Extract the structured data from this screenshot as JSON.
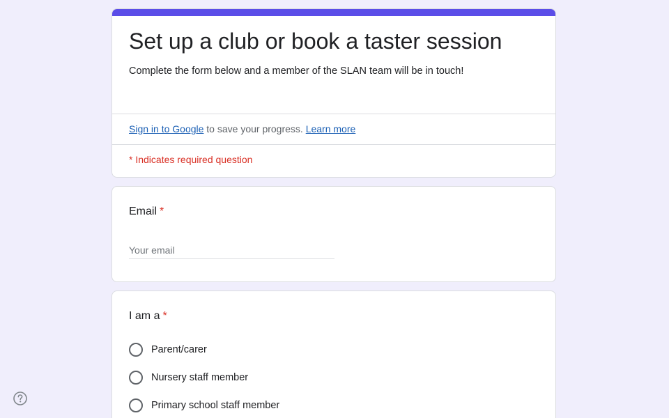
{
  "colors": {
    "accent": "#5b4de8",
    "background": "#f0eefc",
    "required": "#d93025",
    "link": "#1a5fb4"
  },
  "form": {
    "title": "Set up a club or book a taster session",
    "description": "Complete the form below and a member of the SLAN team will be in touch!",
    "signin": {
      "link_label": "Sign in to Google",
      "text": " to save your progress. ",
      "learn_more_label": "Learn more"
    },
    "required_note": "* Indicates required question"
  },
  "questions": {
    "email": {
      "label": "Email",
      "required_mark": "*",
      "value": "",
      "placeholder": "Your email"
    },
    "role": {
      "label": "I am a",
      "required_mark": "*",
      "options": [
        {
          "label": "Parent/carer",
          "selected": false
        },
        {
          "label": "Nursery staff member",
          "selected": false
        },
        {
          "label": "Primary school staff member",
          "selected": false
        }
      ]
    }
  },
  "icons": {
    "help": "help-circle-icon"
  }
}
